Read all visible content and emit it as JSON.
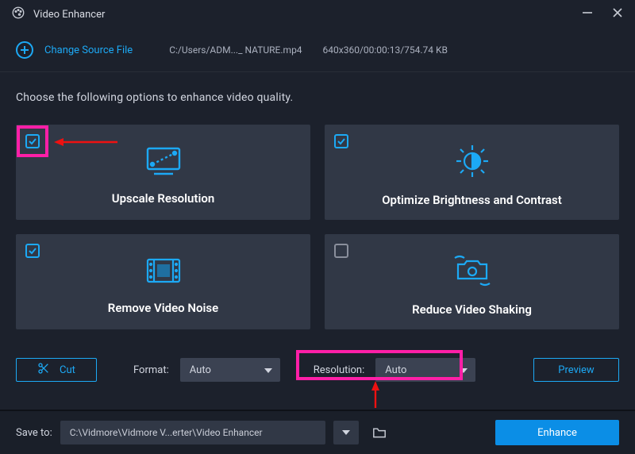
{
  "window": {
    "title": "Video Enhancer"
  },
  "source": {
    "change_label": "Change Source File",
    "path": "C:/Users/ADM..._ NATURE.mp4",
    "info": "640x360/00:00:13/754.74 KB"
  },
  "instruction": "Choose the following options to enhance video quality.",
  "cards": [
    {
      "id": "upscale",
      "label": "Upscale Resolution",
      "checked": true
    },
    {
      "id": "optimize",
      "label": "Optimize Brightness and Contrast",
      "checked": true
    },
    {
      "id": "denoise",
      "label": "Remove Video Noise",
      "checked": true
    },
    {
      "id": "deshake",
      "label": "Reduce Video Shaking",
      "checked": false
    }
  ],
  "controls": {
    "cut_label": "Cut",
    "format_label": "Format:",
    "format_value": "Auto",
    "resolution_label": "Resolution:",
    "resolution_value": "Auto",
    "preview_label": "Preview"
  },
  "bottom": {
    "save_to_label": "Save to:",
    "save_path": "C:\\Vidmore\\Vidmore V...erter\\Video Enhancer",
    "enhance_label": "Enhance"
  },
  "colors": {
    "accent": "#1ca9f5",
    "primary_button": "#0b8ee6",
    "annotation": "#ff1fa7"
  }
}
